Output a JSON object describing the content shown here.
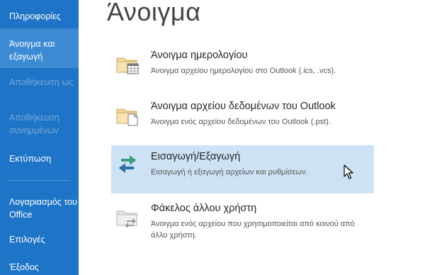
{
  "sidebar": {
    "items": [
      {
        "label": "Πληροφορίες"
      },
      {
        "label": "Άνοιγμα και εξαγωγή"
      },
      {
        "label": "Αποθήκευση ως"
      },
      {
        "label": "Αποθήκευση συνημμένων"
      },
      {
        "label": "Εκτύπωση"
      },
      {
        "label": "Λογαριασμός του Office"
      },
      {
        "label": "Επιλογές"
      },
      {
        "label": "Έξοδος"
      }
    ]
  },
  "main": {
    "title": "Άνοιγμα",
    "options": [
      {
        "title": "Άνοιγμα ημερολογίου",
        "description": "Άνοιγμα αρχείου ημερολογίου στο Outlook (.ics, .vcs).",
        "icon": "folder-calendar-icon"
      },
      {
        "title": "Άνοιγμα αρχείου δεδομένων του Outlook",
        "description": "Άνοιγμα ενός αρχείου δεδομένων του Outlook (.pst).",
        "icon": "folder-file-icon"
      },
      {
        "title": "Εισαγωγή/Εξαγωγή",
        "description": "Εισαγωγή ή εξαγωγή αρχείων και ρυθμίσεων.",
        "icon": "import-export-arrows-icon"
      },
      {
        "title": "Φάκελος άλλου χρήστη",
        "description": "Άνοιγμα ενός αρχείου που χρησιμοποιείται από κοινού από άλλο χρήστη.",
        "icon": "shared-folder-icon"
      }
    ]
  },
  "colors": {
    "sidebar_bg": "#1e74c6",
    "sidebar_active": "#3b8ad3",
    "selected_option": "#cde3f5"
  }
}
